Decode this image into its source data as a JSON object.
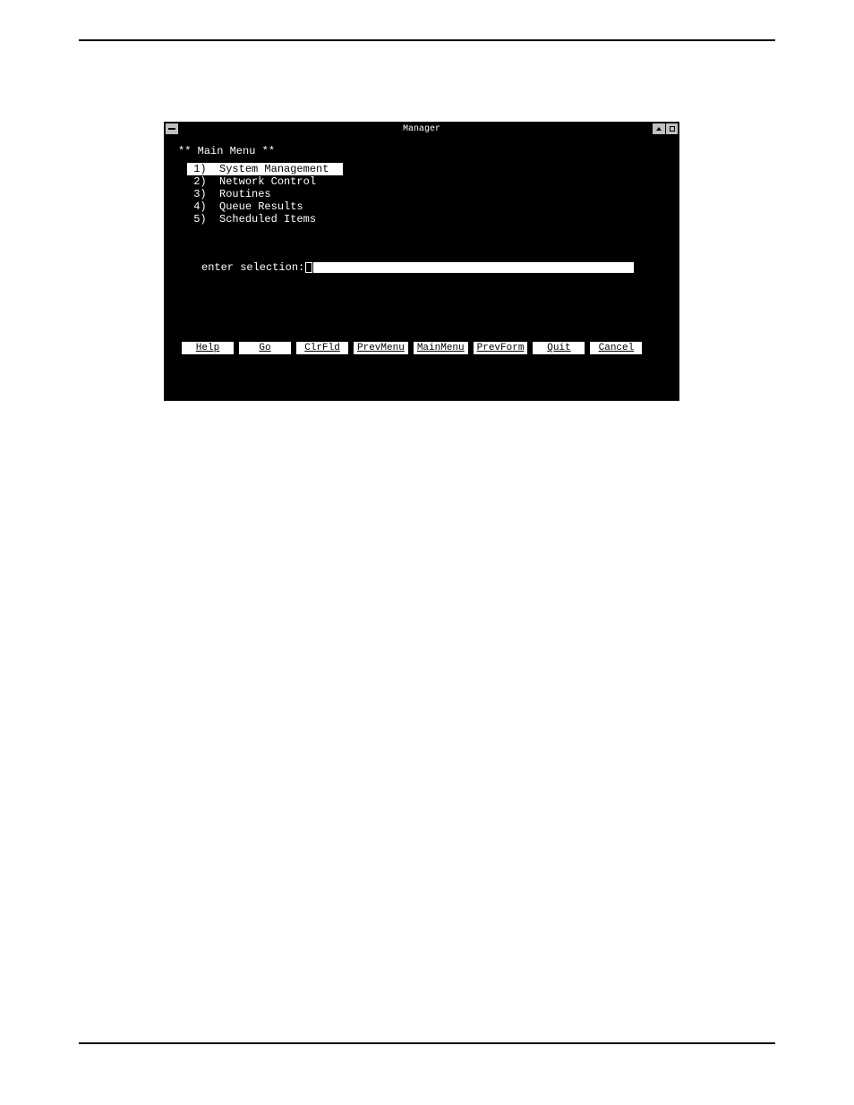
{
  "window": {
    "title": "Manager"
  },
  "menu": {
    "heading": "** Main Menu **",
    "items": [
      {
        "num": "1)",
        "label": "System Management",
        "selected": true
      },
      {
        "num": "2)",
        "label": "Network Control",
        "selected": false
      },
      {
        "num": "3)",
        "label": "Routines",
        "selected": false
      },
      {
        "num": "4)",
        "label": "Queue Results",
        "selected": false
      },
      {
        "num": "5)",
        "label": "Scheduled Items",
        "selected": false
      }
    ]
  },
  "prompt": {
    "label": "enter selection:",
    "value": ""
  },
  "buttons": [
    "Help",
    "Go",
    "ClrFld",
    "PrevMenu",
    "MainMenu",
    "PrevForm",
    "Quit",
    "Cancel"
  ]
}
